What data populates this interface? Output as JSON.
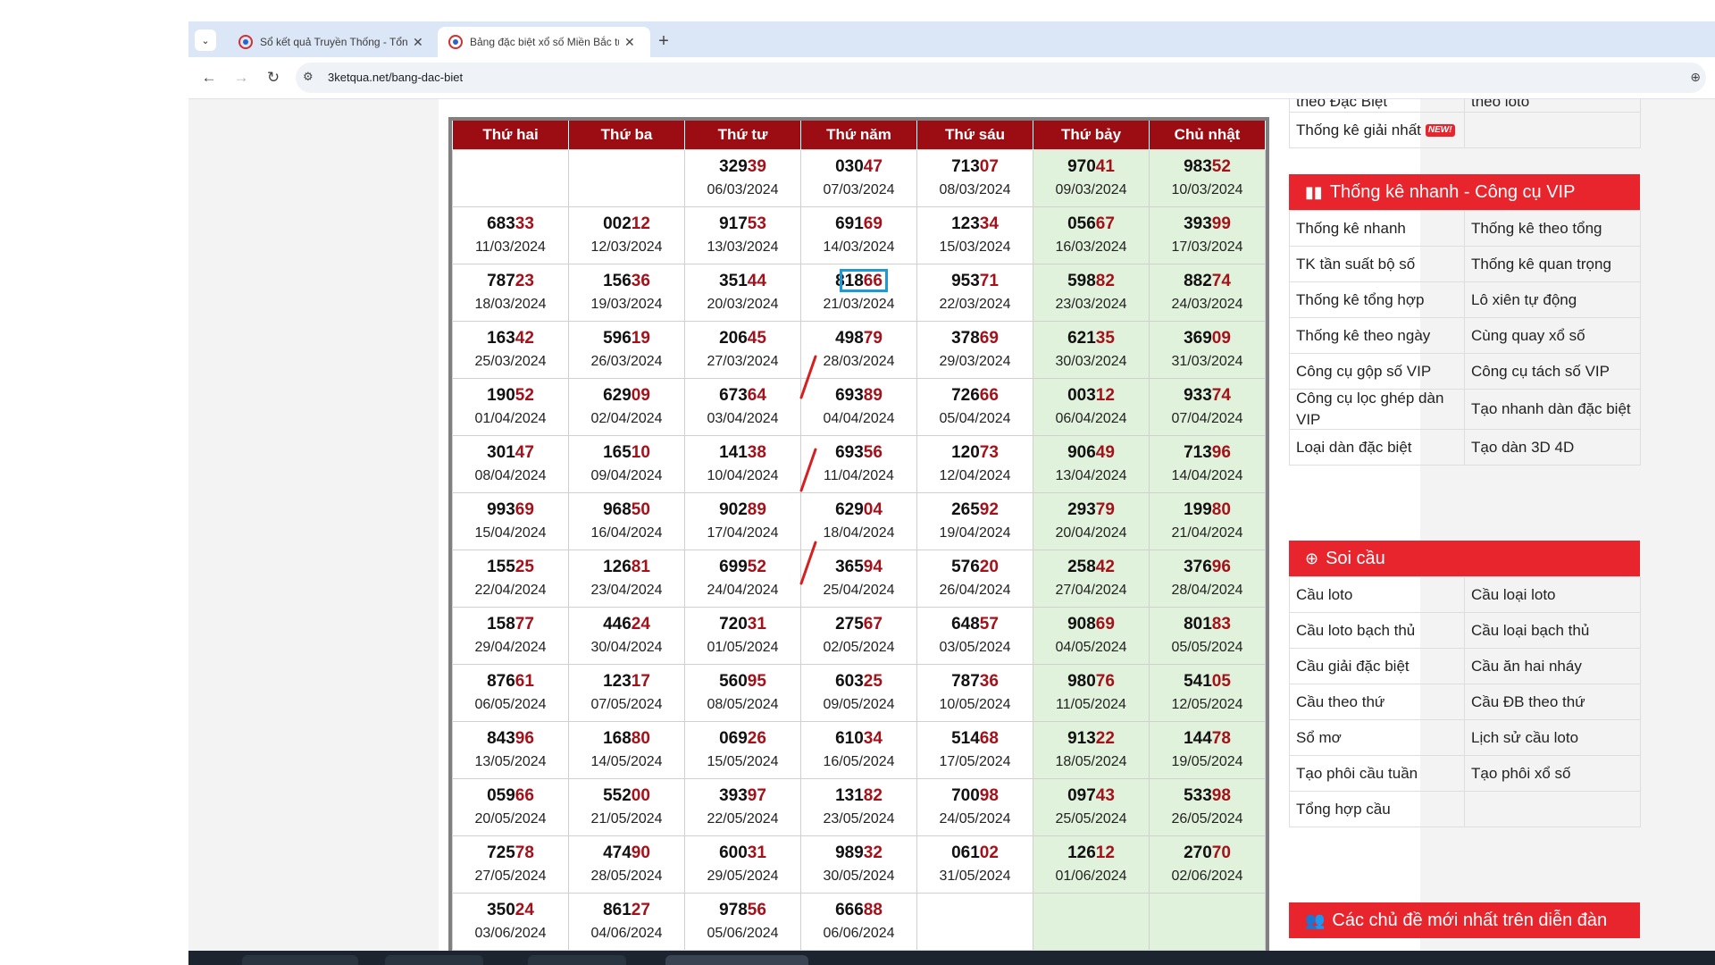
{
  "browser": {
    "tabs": [
      {
        "title": "Sổ kết quả Truyền Thống - Tổng",
        "close": "✕"
      },
      {
        "title": "Bảng đặc biệt xổ số Miền Bắc tuần",
        "close": "✕"
      }
    ],
    "new_tab": "+",
    "url": "3ketqua.net/bang-dac-biet"
  },
  "calendar": {
    "headers": [
      "Thứ hai",
      "Thứ ba",
      "Thứ tư",
      "Thứ năm",
      "Thứ sáu",
      "Thứ bảy",
      "Chủ nhật"
    ],
    "rows": [
      [
        {
          "p": "",
          "h": "",
          "d": ""
        },
        {
          "p": "",
          "h": "",
          "d": ""
        },
        {
          "p": "329",
          "h": "39",
          "d": "06/03/2024"
        },
        {
          "p": "030",
          "h": "47",
          "d": "07/03/2024"
        },
        {
          "p": "713",
          "h": "07",
          "d": "08/03/2024"
        },
        {
          "p": "970",
          "h": "41",
          "d": "09/03/2024"
        },
        {
          "p": "983",
          "h": "52",
          "d": "10/03/2024"
        }
      ],
      [
        {
          "p": "683",
          "h": "33",
          "d": "11/03/2024"
        },
        {
          "p": "002",
          "h": "12",
          "d": "12/03/2024"
        },
        {
          "p": "917",
          "h": "53",
          "d": "13/03/2024"
        },
        {
          "p": "691",
          "h": "69",
          "d": "14/03/2024"
        },
        {
          "p": "123",
          "h": "34",
          "d": "15/03/2024"
        },
        {
          "p": "056",
          "h": "67",
          "d": "16/03/2024"
        },
        {
          "p": "393",
          "h": "99",
          "d": "17/03/2024"
        }
      ],
      [
        {
          "p": "787",
          "h": "23",
          "d": "18/03/2024"
        },
        {
          "p": "156",
          "h": "36",
          "d": "19/03/2024"
        },
        {
          "p": "351",
          "h": "44",
          "d": "20/03/2024"
        },
        {
          "p": "818",
          "h": "66",
          "d": "21/03/2024"
        },
        {
          "p": "953",
          "h": "71",
          "d": "22/03/2024"
        },
        {
          "p": "598",
          "h": "82",
          "d": "23/03/2024"
        },
        {
          "p": "882",
          "h": "74",
          "d": "24/03/2024"
        }
      ],
      [
        {
          "p": "163",
          "h": "42",
          "d": "25/03/2024"
        },
        {
          "p": "596",
          "h": "19",
          "d": "26/03/2024"
        },
        {
          "p": "206",
          "h": "45",
          "d": "27/03/2024"
        },
        {
          "p": "498",
          "h": "79",
          "d": "28/03/2024"
        },
        {
          "p": "378",
          "h": "69",
          "d": "29/03/2024"
        },
        {
          "p": "621",
          "h": "35",
          "d": "30/03/2024"
        },
        {
          "p": "369",
          "h": "09",
          "d": "31/03/2024"
        }
      ],
      [
        {
          "p": "190",
          "h": "52",
          "d": "01/04/2024"
        },
        {
          "p": "629",
          "h": "09",
          "d": "02/04/2024"
        },
        {
          "p": "673",
          "h": "64",
          "d": "03/04/2024"
        },
        {
          "p": "693",
          "h": "89",
          "d": "04/04/2024"
        },
        {
          "p": "726",
          "h": "66",
          "d": "05/04/2024"
        },
        {
          "p": "003",
          "h": "12",
          "d": "06/04/2024"
        },
        {
          "p": "933",
          "h": "74",
          "d": "07/04/2024"
        }
      ],
      [
        {
          "p": "301",
          "h": "47",
          "d": "08/04/2024"
        },
        {
          "p": "165",
          "h": "10",
          "d": "09/04/2024"
        },
        {
          "p": "141",
          "h": "38",
          "d": "10/04/2024"
        },
        {
          "p": "693",
          "h": "56",
          "d": "11/04/2024"
        },
        {
          "p": "120",
          "h": "73",
          "d": "12/04/2024"
        },
        {
          "p": "906",
          "h": "49",
          "d": "13/04/2024"
        },
        {
          "p": "713",
          "h": "96",
          "d": "14/04/2024"
        }
      ],
      [
        {
          "p": "993",
          "h": "69",
          "d": "15/04/2024"
        },
        {
          "p": "968",
          "h": "50",
          "d": "16/04/2024"
        },
        {
          "p": "902",
          "h": "89",
          "d": "17/04/2024"
        },
        {
          "p": "629",
          "h": "04",
          "d": "18/04/2024"
        },
        {
          "p": "265",
          "h": "92",
          "d": "19/04/2024"
        },
        {
          "p": "293",
          "h": "79",
          "d": "20/04/2024"
        },
        {
          "p": "199",
          "h": "80",
          "d": "21/04/2024"
        }
      ],
      [
        {
          "p": "155",
          "h": "25",
          "d": "22/04/2024"
        },
        {
          "p": "126",
          "h": "81",
          "d": "23/04/2024"
        },
        {
          "p": "699",
          "h": "52",
          "d": "24/04/2024"
        },
        {
          "p": "365",
          "h": "94",
          "d": "25/04/2024"
        },
        {
          "p": "576",
          "h": "20",
          "d": "26/04/2024"
        },
        {
          "p": "258",
          "h": "42",
          "d": "27/04/2024"
        },
        {
          "p": "376",
          "h": "96",
          "d": "28/04/2024"
        }
      ],
      [
        {
          "p": "158",
          "h": "77",
          "d": "29/04/2024"
        },
        {
          "p": "446",
          "h": "24",
          "d": "30/04/2024"
        },
        {
          "p": "720",
          "h": "31",
          "d": "01/05/2024"
        },
        {
          "p": "275",
          "h": "67",
          "d": "02/05/2024"
        },
        {
          "p": "648",
          "h": "57",
          "d": "03/05/2024"
        },
        {
          "p": "908",
          "h": "69",
          "d": "04/05/2024"
        },
        {
          "p": "801",
          "h": "83",
          "d": "05/05/2024"
        }
      ],
      [
        {
          "p": "876",
          "h": "61",
          "d": "06/05/2024"
        },
        {
          "p": "123",
          "h": "17",
          "d": "07/05/2024"
        },
        {
          "p": "560",
          "h": "95",
          "d": "08/05/2024"
        },
        {
          "p": "603",
          "h": "25",
          "d": "09/05/2024"
        },
        {
          "p": "787",
          "h": "36",
          "d": "10/05/2024"
        },
        {
          "p": "980",
          "h": "76",
          "d": "11/05/2024"
        },
        {
          "p": "541",
          "h": "05",
          "d": "12/05/2024"
        }
      ],
      [
        {
          "p": "843",
          "h": "96",
          "d": "13/05/2024"
        },
        {
          "p": "168",
          "h": "80",
          "d": "14/05/2024"
        },
        {
          "p": "069",
          "h": "26",
          "d": "15/05/2024"
        },
        {
          "p": "610",
          "h": "34",
          "d": "16/05/2024"
        },
        {
          "p": "514",
          "h": "68",
          "d": "17/05/2024"
        },
        {
          "p": "913",
          "h": "22",
          "d": "18/05/2024"
        },
        {
          "p": "144",
          "h": "78",
          "d": "19/05/2024"
        }
      ],
      [
        {
          "p": "059",
          "h": "66",
          "d": "20/05/2024"
        },
        {
          "p": "552",
          "h": "00",
          "d": "21/05/2024"
        },
        {
          "p": "393",
          "h": "97",
          "d": "22/05/2024"
        },
        {
          "p": "131",
          "h": "82",
          "d": "23/05/2024"
        },
        {
          "p": "700",
          "h": "98",
          "d": "24/05/2024"
        },
        {
          "p": "097",
          "h": "43",
          "d": "25/05/2024"
        },
        {
          "p": "533",
          "h": "98",
          "d": "26/05/2024"
        }
      ],
      [
        {
          "p": "725",
          "h": "78",
          "d": "27/05/2024"
        },
        {
          "p": "474",
          "h": "90",
          "d": "28/05/2024"
        },
        {
          "p": "600",
          "h": "31",
          "d": "29/05/2024"
        },
        {
          "p": "989",
          "h": "32",
          "d": "30/05/2024"
        },
        {
          "p": "061",
          "h": "02",
          "d": "31/05/2024"
        },
        {
          "p": "126",
          "h": "12",
          "d": "01/06/2024"
        },
        {
          "p": "270",
          "h": "70",
          "d": "02/06/2024"
        }
      ],
      [
        {
          "p": "350",
          "h": "24",
          "d": "03/06/2024"
        },
        {
          "p": "861",
          "h": "27",
          "d": "04/06/2024"
        },
        {
          "p": "978",
          "h": "56",
          "d": "05/06/2024"
        },
        {
          "p": "666",
          "h": "88",
          "d": "06/06/2024"
        },
        {
          "p": "",
          "h": "",
          "d": ""
        },
        {
          "p": "",
          "h": "",
          "d": ""
        },
        {
          "p": "",
          "h": "",
          "d": ""
        }
      ]
    ]
  },
  "sidebar": {
    "top_items": [
      "theo Đặc Biệt",
      "theo loto",
      "Thống kê giải nhất",
      ""
    ],
    "new_badge": "NEW!",
    "section1": {
      "title": "Thống kê nhanh - Công cụ VIP",
      "items": [
        "Thống kê nhanh",
        "Thống kê theo tổng",
        "TK tần suất bộ số",
        "Thống kê quan trọng",
        "Thống kê tổng hợp",
        "Lô xiên tự động",
        "Thống kê theo ngày",
        "Cùng quay xổ số",
        "Công cụ gộp số VIP",
        "Công cụ tách số VIP",
        "Công cụ lọc ghép dàn VIP",
        "Tạo nhanh dàn đặc biệt",
        "Loại dàn đặc biệt",
        "Tạo dàn 3D 4D"
      ]
    },
    "section2": {
      "title": "Soi cầu",
      "items": [
        "Cầu loto",
        "Cầu loại loto",
        "Cầu loto bạch thủ",
        "Cầu loại bạch thủ",
        "Cầu giải đặc biệt",
        "Cầu ăn hai nháy",
        "Cầu theo thứ",
        "Cầu ĐB theo thứ",
        "Sổ mơ",
        "Lịch sử cầu loto",
        "Tạo phôi cầu tuần",
        "Tạo phôi xổ số",
        "Tổng hợp cầu",
        ""
      ]
    },
    "section3": {
      "title": "Các chủ đề mới nhất trên diễn đàn"
    }
  },
  "colors": {
    "header_red": "#9b0d13",
    "highlight_digits": "#a3121b",
    "weekend_bg": "#e1f2dc",
    "sidebar_red": "#e8242c",
    "selection_box": "#1b9ad6",
    "annotation_stroke": "#d61f1f"
  },
  "icons": {
    "tab_search": "chevron-down-icon",
    "favicon": "lottery-site-favicon",
    "back": "arrow-left-icon",
    "forward": "arrow-right-icon",
    "reload": "reload-icon",
    "site_info": "site-settings-icon",
    "zoom": "zoom-icon",
    "section1": "bar-chart-icon",
    "section2": "search-plus-icon",
    "section3": "users-icon"
  }
}
